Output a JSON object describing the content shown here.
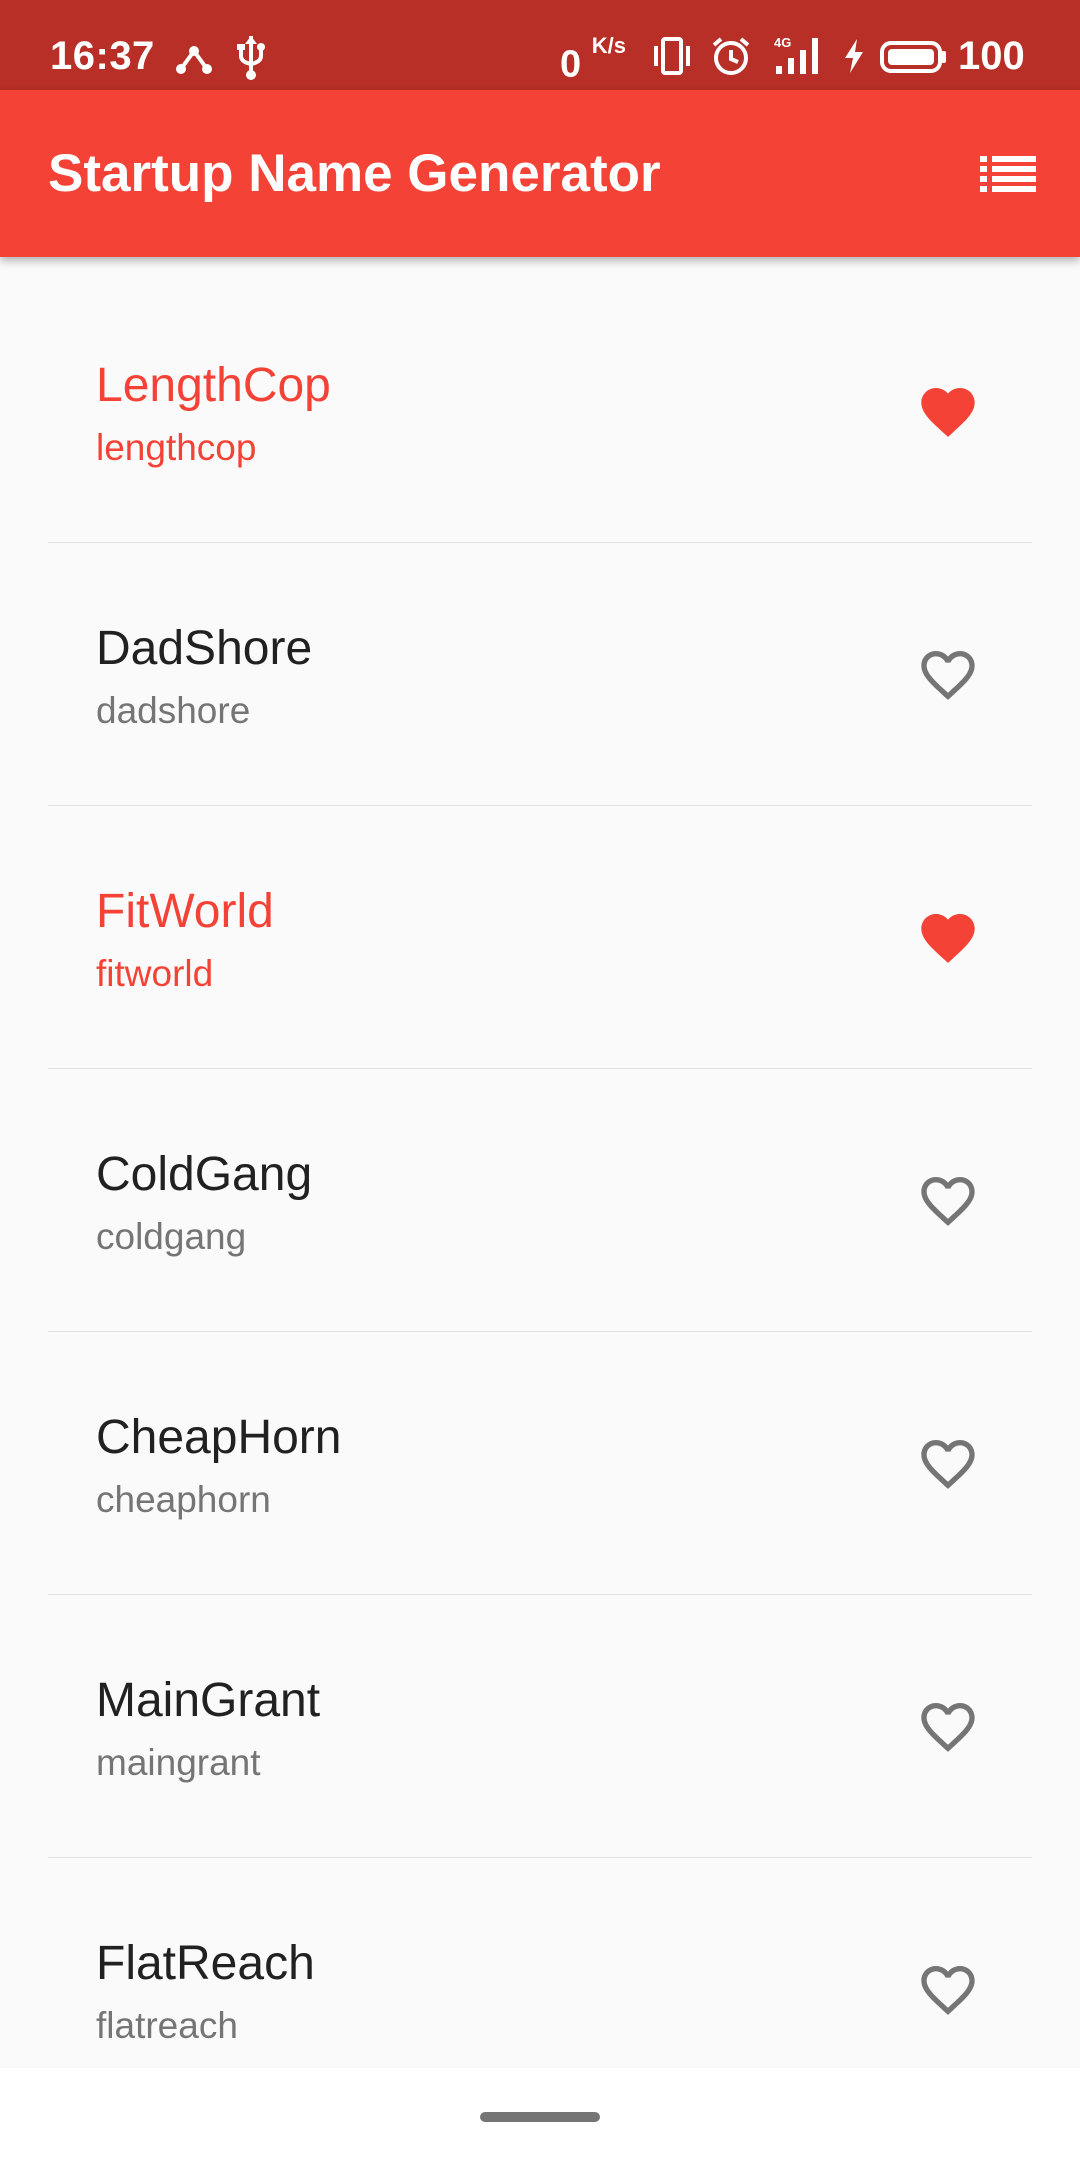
{
  "status_bar": {
    "time": "16:37",
    "net_speed_value": "0",
    "net_speed_unit": "K/s",
    "network_type": "4G",
    "battery_level": "100",
    "icons": [
      "share-icon",
      "usb-icon",
      "vibrate-icon",
      "alarm-icon",
      "signal-4g-icon",
      "charging-icon",
      "battery-icon"
    ]
  },
  "app_bar": {
    "title": "Startup Name Generator",
    "action_icon": "list-icon"
  },
  "colors": {
    "primary": "#f44336",
    "primary_dark": "#b72f26",
    "text_primary": "#212121",
    "text_secondary": "#757575",
    "heart_unsaved": "#757575"
  },
  "names": [
    {
      "title": "LengthCop",
      "subtitle": "lengthcop",
      "saved": true
    },
    {
      "title": "DadShore",
      "subtitle": "dadshore",
      "saved": false
    },
    {
      "title": "FitWorld",
      "subtitle": "fitworld",
      "saved": true
    },
    {
      "title": "ColdGang",
      "subtitle": "coldgang",
      "saved": false
    },
    {
      "title": "CheapHorn",
      "subtitle": "cheaphorn",
      "saved": false
    },
    {
      "title": "MainGrant",
      "subtitle": "maingrant",
      "saved": false
    },
    {
      "title": "FlatReach",
      "subtitle": "flatreach",
      "saved": false
    }
  ]
}
